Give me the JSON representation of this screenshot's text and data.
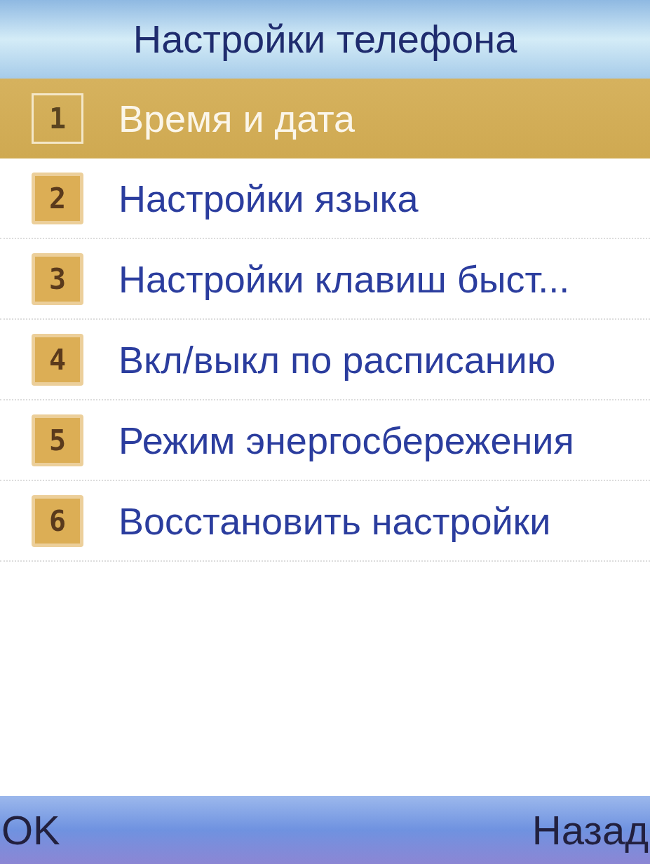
{
  "title": "Настройки телефона",
  "menu": [
    {
      "number": "1",
      "label": "Время и дата",
      "selected": true
    },
    {
      "number": "2",
      "label": "Настройки языка",
      "selected": false
    },
    {
      "number": "3",
      "label": "Настройки клавиш быст...",
      "selected": false
    },
    {
      "number": "4",
      "label": "Вкл/выкл по расписанию",
      "selected": false
    },
    {
      "number": "5",
      "label": "Режим энергосбережения",
      "selected": false
    },
    {
      "number": "6",
      "label": "Восстановить настройки",
      "selected": false
    }
  ],
  "softkeys": {
    "left": "OK",
    "right": "Назад"
  }
}
